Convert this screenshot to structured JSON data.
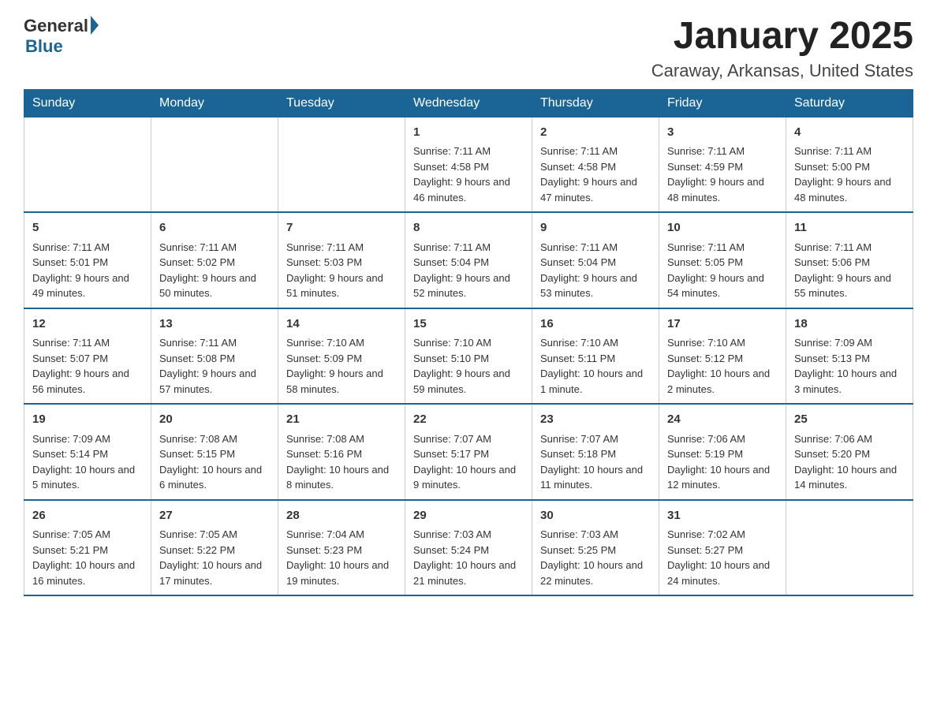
{
  "logo": {
    "general": "General",
    "blue": "Blue"
  },
  "header": {
    "title": "January 2025",
    "subtitle": "Caraway, Arkansas, United States"
  },
  "days": [
    "Sunday",
    "Monday",
    "Tuesday",
    "Wednesday",
    "Thursday",
    "Friday",
    "Saturday"
  ],
  "weeks": [
    [
      {
        "num": "",
        "sunrise": "",
        "sunset": "",
        "daylight": ""
      },
      {
        "num": "",
        "sunrise": "",
        "sunset": "",
        "daylight": ""
      },
      {
        "num": "",
        "sunrise": "",
        "sunset": "",
        "daylight": ""
      },
      {
        "num": "1",
        "sunrise": "Sunrise: 7:11 AM",
        "sunset": "Sunset: 4:58 PM",
        "daylight": "Daylight: 9 hours and 46 minutes."
      },
      {
        "num": "2",
        "sunrise": "Sunrise: 7:11 AM",
        "sunset": "Sunset: 4:58 PM",
        "daylight": "Daylight: 9 hours and 47 minutes."
      },
      {
        "num": "3",
        "sunrise": "Sunrise: 7:11 AM",
        "sunset": "Sunset: 4:59 PM",
        "daylight": "Daylight: 9 hours and 48 minutes."
      },
      {
        "num": "4",
        "sunrise": "Sunrise: 7:11 AM",
        "sunset": "Sunset: 5:00 PM",
        "daylight": "Daylight: 9 hours and 48 minutes."
      }
    ],
    [
      {
        "num": "5",
        "sunrise": "Sunrise: 7:11 AM",
        "sunset": "Sunset: 5:01 PM",
        "daylight": "Daylight: 9 hours and 49 minutes."
      },
      {
        "num": "6",
        "sunrise": "Sunrise: 7:11 AM",
        "sunset": "Sunset: 5:02 PM",
        "daylight": "Daylight: 9 hours and 50 minutes."
      },
      {
        "num": "7",
        "sunrise": "Sunrise: 7:11 AM",
        "sunset": "Sunset: 5:03 PM",
        "daylight": "Daylight: 9 hours and 51 minutes."
      },
      {
        "num": "8",
        "sunrise": "Sunrise: 7:11 AM",
        "sunset": "Sunset: 5:04 PM",
        "daylight": "Daylight: 9 hours and 52 minutes."
      },
      {
        "num": "9",
        "sunrise": "Sunrise: 7:11 AM",
        "sunset": "Sunset: 5:04 PM",
        "daylight": "Daylight: 9 hours and 53 minutes."
      },
      {
        "num": "10",
        "sunrise": "Sunrise: 7:11 AM",
        "sunset": "Sunset: 5:05 PM",
        "daylight": "Daylight: 9 hours and 54 minutes."
      },
      {
        "num": "11",
        "sunrise": "Sunrise: 7:11 AM",
        "sunset": "Sunset: 5:06 PM",
        "daylight": "Daylight: 9 hours and 55 minutes."
      }
    ],
    [
      {
        "num": "12",
        "sunrise": "Sunrise: 7:11 AM",
        "sunset": "Sunset: 5:07 PM",
        "daylight": "Daylight: 9 hours and 56 minutes."
      },
      {
        "num": "13",
        "sunrise": "Sunrise: 7:11 AM",
        "sunset": "Sunset: 5:08 PM",
        "daylight": "Daylight: 9 hours and 57 minutes."
      },
      {
        "num": "14",
        "sunrise": "Sunrise: 7:10 AM",
        "sunset": "Sunset: 5:09 PM",
        "daylight": "Daylight: 9 hours and 58 minutes."
      },
      {
        "num": "15",
        "sunrise": "Sunrise: 7:10 AM",
        "sunset": "Sunset: 5:10 PM",
        "daylight": "Daylight: 9 hours and 59 minutes."
      },
      {
        "num": "16",
        "sunrise": "Sunrise: 7:10 AM",
        "sunset": "Sunset: 5:11 PM",
        "daylight": "Daylight: 10 hours and 1 minute."
      },
      {
        "num": "17",
        "sunrise": "Sunrise: 7:10 AM",
        "sunset": "Sunset: 5:12 PM",
        "daylight": "Daylight: 10 hours and 2 minutes."
      },
      {
        "num": "18",
        "sunrise": "Sunrise: 7:09 AM",
        "sunset": "Sunset: 5:13 PM",
        "daylight": "Daylight: 10 hours and 3 minutes."
      }
    ],
    [
      {
        "num": "19",
        "sunrise": "Sunrise: 7:09 AM",
        "sunset": "Sunset: 5:14 PM",
        "daylight": "Daylight: 10 hours and 5 minutes."
      },
      {
        "num": "20",
        "sunrise": "Sunrise: 7:08 AM",
        "sunset": "Sunset: 5:15 PM",
        "daylight": "Daylight: 10 hours and 6 minutes."
      },
      {
        "num": "21",
        "sunrise": "Sunrise: 7:08 AM",
        "sunset": "Sunset: 5:16 PM",
        "daylight": "Daylight: 10 hours and 8 minutes."
      },
      {
        "num": "22",
        "sunrise": "Sunrise: 7:07 AM",
        "sunset": "Sunset: 5:17 PM",
        "daylight": "Daylight: 10 hours and 9 minutes."
      },
      {
        "num": "23",
        "sunrise": "Sunrise: 7:07 AM",
        "sunset": "Sunset: 5:18 PM",
        "daylight": "Daylight: 10 hours and 11 minutes."
      },
      {
        "num": "24",
        "sunrise": "Sunrise: 7:06 AM",
        "sunset": "Sunset: 5:19 PM",
        "daylight": "Daylight: 10 hours and 12 minutes."
      },
      {
        "num": "25",
        "sunrise": "Sunrise: 7:06 AM",
        "sunset": "Sunset: 5:20 PM",
        "daylight": "Daylight: 10 hours and 14 minutes."
      }
    ],
    [
      {
        "num": "26",
        "sunrise": "Sunrise: 7:05 AM",
        "sunset": "Sunset: 5:21 PM",
        "daylight": "Daylight: 10 hours and 16 minutes."
      },
      {
        "num": "27",
        "sunrise": "Sunrise: 7:05 AM",
        "sunset": "Sunset: 5:22 PM",
        "daylight": "Daylight: 10 hours and 17 minutes."
      },
      {
        "num": "28",
        "sunrise": "Sunrise: 7:04 AM",
        "sunset": "Sunset: 5:23 PM",
        "daylight": "Daylight: 10 hours and 19 minutes."
      },
      {
        "num": "29",
        "sunrise": "Sunrise: 7:03 AM",
        "sunset": "Sunset: 5:24 PM",
        "daylight": "Daylight: 10 hours and 21 minutes."
      },
      {
        "num": "30",
        "sunrise": "Sunrise: 7:03 AM",
        "sunset": "Sunset: 5:25 PM",
        "daylight": "Daylight: 10 hours and 22 minutes."
      },
      {
        "num": "31",
        "sunrise": "Sunrise: 7:02 AM",
        "sunset": "Sunset: 5:27 PM",
        "daylight": "Daylight: 10 hours and 24 minutes."
      },
      {
        "num": "",
        "sunrise": "",
        "sunset": "",
        "daylight": ""
      }
    ]
  ],
  "accent_color": "#1a6496"
}
